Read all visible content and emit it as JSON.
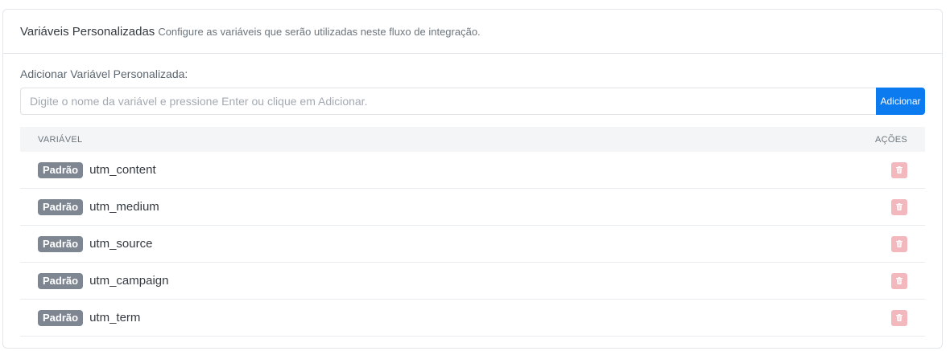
{
  "header": {
    "title": "Variáveis Personalizadas",
    "subtitle": "Configure as variáveis que serão utilizadas neste fluxo de integração."
  },
  "form": {
    "label": "Adicionar Variável Personalizada:",
    "placeholder": "Digite o nome da variável e pressione Enter ou clique em Adicionar.",
    "value": "",
    "button_label": "Adicionar"
  },
  "table": {
    "columns": [
      "VARIÁVEL",
      "AÇÕES"
    ],
    "rows": [
      {
        "badge": "Padrão",
        "name": "utm_content",
        "action_icon": "trash-icon"
      },
      {
        "badge": "Padrão",
        "name": "utm_medium",
        "action_icon": "trash-icon"
      },
      {
        "badge": "Padrão",
        "name": "utm_source",
        "action_icon": "trash-icon"
      },
      {
        "badge": "Padrão",
        "name": "utm_campaign",
        "action_icon": "trash-icon"
      },
      {
        "badge": "Padrão",
        "name": "utm_term",
        "action_icon": "trash-icon"
      }
    ]
  },
  "colors": {
    "accent": "#0d7bf0",
    "badge": "#7e8691",
    "delete": "#f2b8bd"
  }
}
